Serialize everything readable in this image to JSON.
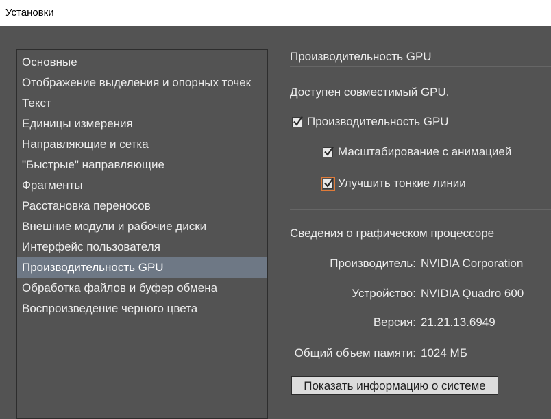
{
  "window": {
    "title": "Установки"
  },
  "sidebar": {
    "items": [
      {
        "label": "Основные"
      },
      {
        "label": "Отображение выделения и опорных точек"
      },
      {
        "label": "Текст"
      },
      {
        "label": "Единицы измерения"
      },
      {
        "label": "Направляющие и сетка"
      },
      {
        "label": "\"Быстрые\" направляющие"
      },
      {
        "label": "Фрагменты"
      },
      {
        "label": "Расстановка переносов"
      },
      {
        "label": "Внешние модули и рабочие диски"
      },
      {
        "label": "Интерфейс пользователя"
      },
      {
        "label": "Производительность GPU",
        "selected": true
      },
      {
        "label": "Обработка файлов и буфер обмена"
      },
      {
        "label": "Воспроизведение черного цвета"
      }
    ]
  },
  "panel": {
    "section_title": "Производительность GPU",
    "gpu_available": "Доступен совместимый GPU.",
    "checkboxes": {
      "gpu_performance": {
        "label": "Производительность GPU",
        "checked": true
      },
      "animated_zoom": {
        "label": "Масштабирование с анимацией",
        "checked": true
      },
      "enhance_thin_lines": {
        "label": "Улучшить тонкие линии",
        "checked": true
      }
    },
    "gpu_info": {
      "heading": "Сведения о графическом процессоре",
      "vendor_label": "Производитель:",
      "vendor_value": "NVIDIA Corporation",
      "device_label": "Устройство:",
      "device_value": "NVIDIA Quadro 600",
      "version_label": "Версия:",
      "version_value": "21.21.13.6949",
      "memory_label": "Общий объем памяти:",
      "memory_value": "1024 МБ"
    },
    "show_system_info_button": "Показать информацию о системе"
  },
  "colors": {
    "background": "#535353",
    "selected_item": "#6e7885",
    "focus_ring": "#e07b39"
  }
}
